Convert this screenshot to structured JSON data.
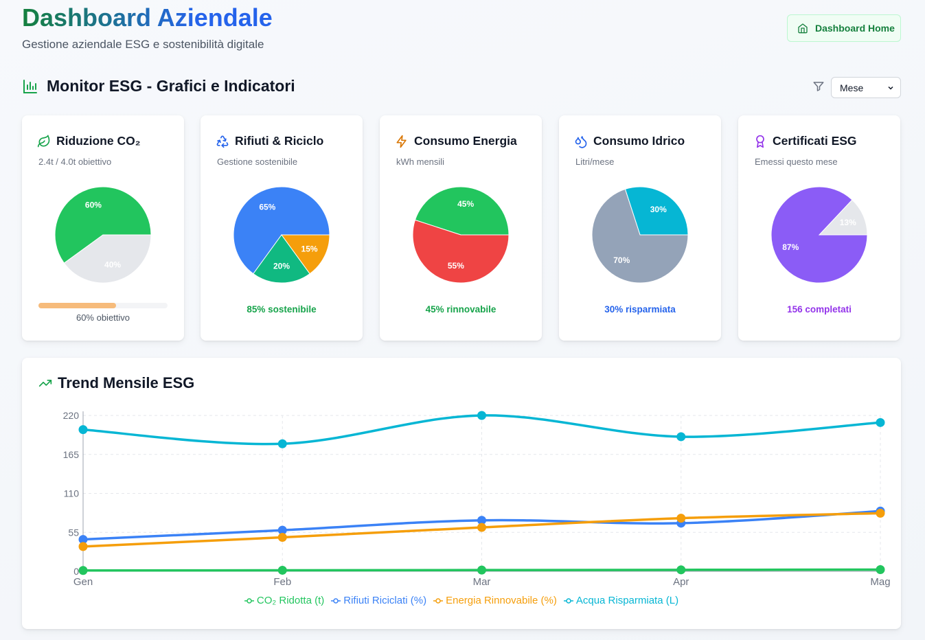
{
  "header": {
    "title": "Dashboard Aziendale",
    "subtitle": "Gestione aziendale ESG e sostenibilità digitale",
    "home_button": "Dashboard Home"
  },
  "section": {
    "title": "Monitor ESG - Grafici e Indicatori",
    "period_selected": "Mese"
  },
  "colors": {
    "green": "#22c55e",
    "blue": "#3b82f6",
    "orange": "#f59e0b",
    "cyan": "#06b6d4",
    "red": "#ef4444",
    "purple": "#8b5cf6",
    "gray": "#e5e7eb",
    "slate": "#94a3b8",
    "teal": "#10b981"
  },
  "cards": [
    {
      "title": "Riduzione CO₂",
      "subtitle": "2.4t / 4.0t obiettivo",
      "icon": "leaf-icon",
      "slices": [
        {
          "label": "60%",
          "value": 60,
          "color": "#22c55e"
        },
        {
          "label": "40%",
          "value": 40,
          "color": "#e5e7eb"
        }
      ],
      "progress": 60,
      "progress_label": "60% obiettivo"
    },
    {
      "title": "Rifiuti & Riciclo",
      "subtitle": "Gestione sostenibile",
      "icon": "recycle-icon",
      "slices": [
        {
          "label": "65%",
          "value": 65,
          "color": "#3b82f6"
        },
        {
          "label": "20%",
          "value": 20,
          "color": "#10b981"
        },
        {
          "label": "15%",
          "value": 15,
          "color": "#f59e0b"
        }
      ],
      "footer": "85% sostenibile",
      "footer_color": "#16a34a"
    },
    {
      "title": "Consumo Energia",
      "subtitle": "kWh mensili",
      "icon": "lightning-icon",
      "slices": [
        {
          "label": "45%",
          "value": 45,
          "color": "#22c55e"
        },
        {
          "label": "55%",
          "value": 55,
          "color": "#ef4444"
        }
      ],
      "footer": "45% rinnovabile",
      "footer_color": "#16a34a"
    },
    {
      "title": "Consumo Idrico",
      "subtitle": "Litri/mese",
      "icon": "droplets-icon",
      "slices": [
        {
          "label": "30%",
          "value": 30,
          "color": "#06b6d4"
        },
        {
          "label": "70%",
          "value": 70,
          "color": "#94a3b8"
        }
      ],
      "footer": "30% risparmiata",
      "footer_color": "#2563eb"
    },
    {
      "title": "Certificati ESG",
      "subtitle": "Emessi questo mese",
      "icon": "award-icon",
      "slices": [
        {
          "label": "13%",
          "value": 13,
          "color": "#e5e7eb"
        },
        {
          "label": "87%",
          "value": 87,
          "color": "#8b5cf6"
        }
      ],
      "footer": "156 completati",
      "footer_color": "#9333ea"
    }
  ],
  "trend": {
    "title": "Trend Mensile ESG"
  },
  "chart_data": {
    "type": "line",
    "title": "Trend Mensile ESG",
    "categories": [
      "Gen",
      "Feb",
      "Mar",
      "Apr",
      "Mag"
    ],
    "y_ticks": [
      0,
      55,
      110,
      165,
      220
    ],
    "ylim": [
      0,
      220
    ],
    "grid": true,
    "legend_position": "bottom",
    "series": [
      {
        "name": "CO₂ Ridotta (t)",
        "color": "#22c55e",
        "values": [
          1.2,
          1.5,
          1.8,
          2.1,
          2.4
        ]
      },
      {
        "name": "Rifiuti Riciclati (%)",
        "color": "#3b82f6",
        "values": [
          45,
          58,
          72,
          68,
          85
        ]
      },
      {
        "name": "Energia Rinnovabile (%)",
        "color": "#f59e0b",
        "values": [
          35,
          48,
          62,
          75,
          82
        ]
      },
      {
        "name": "Acqua Risparmiata (L)",
        "color": "#06b6d4",
        "values": [
          200,
          180,
          220,
          190,
          210
        ]
      }
    ]
  }
}
